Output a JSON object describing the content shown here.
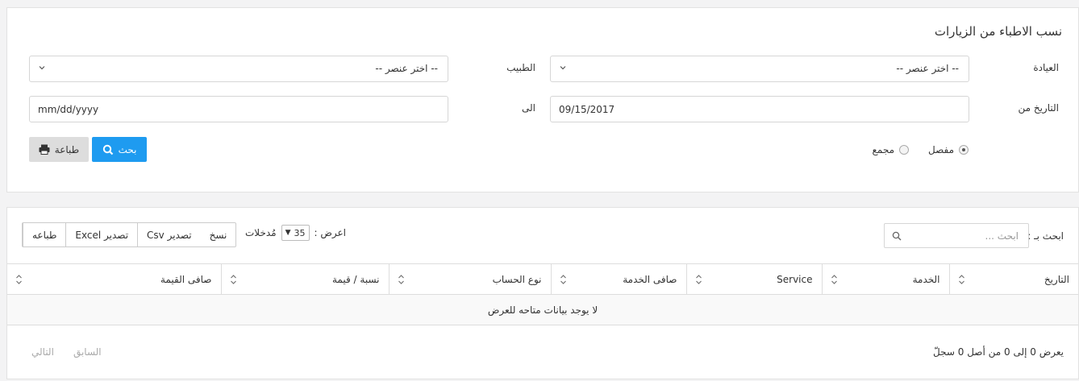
{
  "filter": {
    "title": "نسب الاطباء من الزيارات",
    "clinic_label": "العيادة",
    "clinic_value": "-- اختر عنصر --",
    "doctor_label": "الطبيب",
    "doctor_value": "-- اختر عنصر --",
    "date_from_label": "التاريخ من",
    "date_from_value": "09/15/2017",
    "date_to_label": "الى",
    "date_to_value": "mm/dd/yyyy",
    "radio_detailed": "مفصل",
    "radio_summary": "مجمع",
    "search_button": "بحث",
    "print_button": "طباعة"
  },
  "table_controls": {
    "search_label": "ابحث بـ :",
    "search_placeholder": "ابحث ...",
    "show_label": "اعرض :",
    "page_length": "35",
    "entries_label": "مُدخلات",
    "export_buttons": [
      "نسخ",
      "تصدير Csv",
      "تصدير Excel",
      "طباعه"
    ]
  },
  "table": {
    "columns": [
      "التاريخ",
      "الخدمة",
      "Service",
      "صافى الخدمة",
      "نوع الحساب",
      "نسبة / قيمة",
      "صافى القيمة"
    ],
    "empty_message": "لا يوجد بيانات متاحه للعرض"
  },
  "footer": {
    "info": "يعرض 0 إلى 0 من أصل 0 سجلّ",
    "prev": "السابق",
    "next": "التالي"
  },
  "colors": {
    "primary": "#1e9bf0",
    "default_button": "#dddddd"
  }
}
